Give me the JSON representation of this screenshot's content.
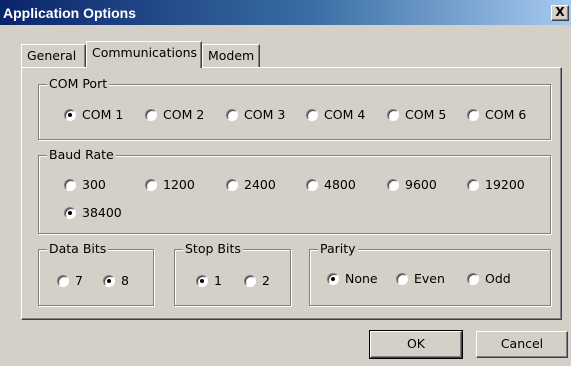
{
  "window": {
    "title": "Application Options",
    "close_label": "X"
  },
  "tabs": [
    {
      "label": "General",
      "selected": false
    },
    {
      "label": "Communications",
      "selected": true
    },
    {
      "label": "Modem",
      "selected": false
    }
  ],
  "com_port": {
    "legend": "COM Port",
    "options": [
      "COM 1",
      "COM 2",
      "COM 3",
      "COM 4",
      "COM 5",
      "COM 6"
    ],
    "selected": "COM 1"
  },
  "baud_rate": {
    "legend": "Baud Rate",
    "options": [
      "300",
      "1200",
      "2400",
      "4800",
      "9600",
      "19200",
      "38400"
    ],
    "selected": "38400"
  },
  "data_bits": {
    "legend": "Data Bits",
    "options": [
      "7",
      "8"
    ],
    "selected": "8"
  },
  "stop_bits": {
    "legend": "Stop Bits",
    "options": [
      "1",
      "2"
    ],
    "selected": "1"
  },
  "parity": {
    "legend": "Parity",
    "options": [
      "None",
      "Even",
      "Odd"
    ],
    "selected": "None"
  },
  "buttons": {
    "ok": "OK",
    "cancel": "Cancel"
  }
}
